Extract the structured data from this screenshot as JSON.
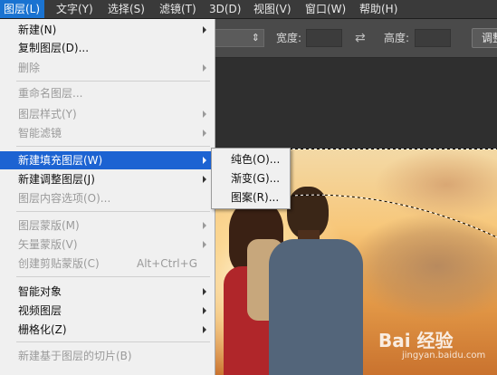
{
  "menubar": {
    "items": [
      {
        "label": "图层(L)"
      },
      {
        "label": "文字(Y)"
      },
      {
        "label": "选择(S)"
      },
      {
        "label": "滤镜(T)"
      },
      {
        "label": "3D(D)"
      },
      {
        "label": "视图(V)"
      },
      {
        "label": "窗口(W)"
      },
      {
        "label": "帮助(H)"
      }
    ]
  },
  "options": {
    "style_value": "",
    "width_label": "宽度:",
    "height_label": "高度:",
    "adjust_button": "调整"
  },
  "layer_menu": {
    "items": [
      {
        "label": "新建(N)",
        "submenu": true,
        "enabled": true
      },
      {
        "label": "复制图层(D)...",
        "enabled": true
      },
      {
        "label": "删除",
        "submenu": true,
        "enabled": false
      },
      {
        "label": "重命名图层...",
        "enabled": false
      },
      {
        "label": "图层样式(Y)",
        "submenu": true,
        "enabled": false
      },
      {
        "label": "智能滤镜",
        "submenu": true,
        "enabled": false
      },
      {
        "label": "新建填充图层(W)",
        "submenu": true,
        "enabled": true,
        "highlighted": true
      },
      {
        "label": "新建调整图层(J)",
        "submenu": true,
        "enabled": true
      },
      {
        "label": "图层内容选项(O)...",
        "enabled": false
      },
      {
        "label": "图层蒙版(M)",
        "submenu": true,
        "enabled": false
      },
      {
        "label": "矢量蒙版(V)",
        "submenu": true,
        "enabled": false
      },
      {
        "label": "创建剪贴蒙版(C)",
        "shortcut": "Alt+Ctrl+G",
        "enabled": false
      },
      {
        "label": "智能对象",
        "submenu": true,
        "enabled": true
      },
      {
        "label": "视频图层",
        "submenu": true,
        "enabled": true
      },
      {
        "label": "栅格化(Z)",
        "submenu": true,
        "enabled": true
      },
      {
        "label": "新建基于图层的切片(B)",
        "enabled": false
      }
    ]
  },
  "fill_submenu": {
    "items": [
      {
        "label": "纯色(O)..."
      },
      {
        "label": "渐变(G)..."
      },
      {
        "label": "图案(R)..."
      }
    ]
  },
  "watermark": {
    "brand": "Bai 经验",
    "url": "jingyan.baidu.com"
  },
  "colors": {
    "highlight": "#1c63d2",
    "menu_bg": "#f0f0f0",
    "app_bg": "#2b2b2b"
  }
}
